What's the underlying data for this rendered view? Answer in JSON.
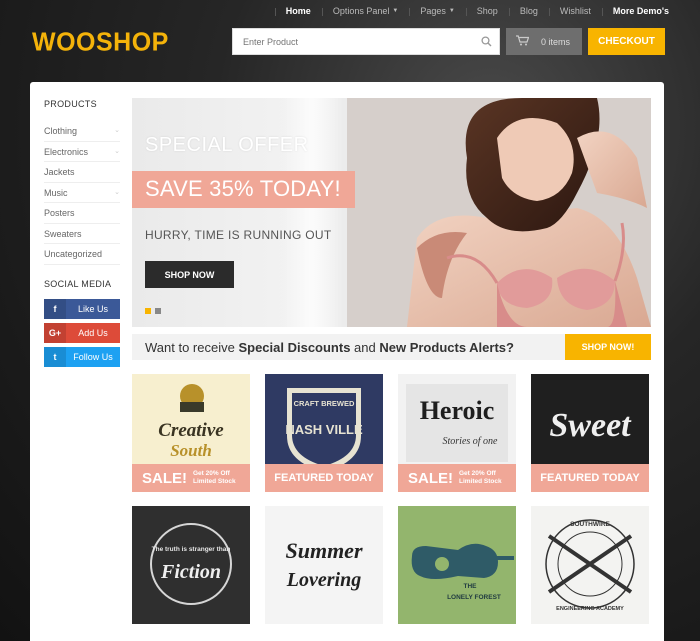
{
  "nav": {
    "items": [
      {
        "label": "Home",
        "style": "active",
        "dropdown": false
      },
      {
        "label": "Options Panel",
        "style": "",
        "dropdown": true
      },
      {
        "label": "Pages",
        "style": "",
        "dropdown": true
      },
      {
        "label": "Shop",
        "style": "",
        "dropdown": false
      },
      {
        "label": "Blog",
        "style": "",
        "dropdown": false
      },
      {
        "label": "Wishlist",
        "style": "",
        "dropdown": false
      },
      {
        "label": "More Demo's",
        "style": "bold",
        "dropdown": false
      }
    ]
  },
  "header": {
    "logo": "WOOSHOP",
    "search_placeholder": "Enter Product",
    "cart_label": "0 items",
    "checkout_label": "CHECKOUT"
  },
  "sidebar": {
    "products_title": "PRODUCTS",
    "categories": [
      {
        "label": "Clothing",
        "has_children": true
      },
      {
        "label": "Electronics",
        "has_children": true
      },
      {
        "label": "Jackets",
        "has_children": false
      },
      {
        "label": "Music",
        "has_children": true
      },
      {
        "label": "Posters",
        "has_children": false
      },
      {
        "label": "Sweaters",
        "has_children": false
      },
      {
        "label": "Uncategorized",
        "has_children": false
      }
    ],
    "social_title": "SOCIAL MEDIA",
    "social": [
      {
        "icon": "f",
        "label": "Like Us",
        "network": "facebook"
      },
      {
        "icon": "G+",
        "label": "Add Us",
        "network": "google-plus"
      },
      {
        "icon": "t",
        "label": "Follow Us",
        "network": "twitter"
      }
    ]
  },
  "hero": {
    "title": "SPECIAL OFFER",
    "headline": "SAVE 35% TODAY!",
    "subtitle": "HURRY, TIME IS RUNNING OUT",
    "button": "SHOP NOW",
    "slides": 2,
    "active_slide": 1
  },
  "promo": {
    "text_1": "Want to receive ",
    "bold_1": "Special Discounts",
    "text_2": " and ",
    "bold_2": "New Products Alerts?",
    "button": "SHOP NOW!"
  },
  "products": [
    {
      "name": "creative-south",
      "art_text_1": "Creative",
      "art_text_2": "South",
      "ribbon": "sale",
      "ribbon_main": "SALE!",
      "ribbon_small_1": "Get 20% Off",
      "ribbon_small_2": "Limited Stock",
      "bg": "#f7efcf"
    },
    {
      "name": "nashville",
      "art_text_1": "CRAFT BREWED",
      "art_text_2": "NASH VILLE",
      "ribbon": "featured",
      "ribbon_main": "FEATURED TODAY",
      "bg": "#2f3a63"
    },
    {
      "name": "heroic",
      "art_text_1": "Heroic",
      "art_text_2": "Stories of one",
      "ribbon": "sale",
      "ribbon_main": "SALE!",
      "ribbon_small_1": "Get 20% Off",
      "ribbon_small_2": "Limited Stock",
      "bg": "#f2f2f2"
    },
    {
      "name": "sweet",
      "art_text_1": "Sweet",
      "art_text_2": "",
      "ribbon": "featured",
      "ribbon_main": "FEATURED TODAY",
      "bg": "#1f1f1f"
    },
    {
      "name": "truth-fiction",
      "art_text_1": "The truth is stranger than",
      "art_text_2": "Fiction",
      "ribbon": "",
      "bg": "#2c2c2c"
    },
    {
      "name": "summer-lovering",
      "art_text_1": "Summer",
      "art_text_2": "Lovering",
      "ribbon": "",
      "bg": "#f4f4f4"
    },
    {
      "name": "lonely-forest",
      "art_text_1": "THE",
      "art_text_2": "LONELY FOREST",
      "ribbon": "",
      "bg": "#93b56d"
    },
    {
      "name": "southwire",
      "art_text_1": "SOUTHWIRE",
      "art_text_2": "ENGINEERING ACADEMY",
      "ribbon": "",
      "bg": "#f3f3f1"
    }
  ]
}
